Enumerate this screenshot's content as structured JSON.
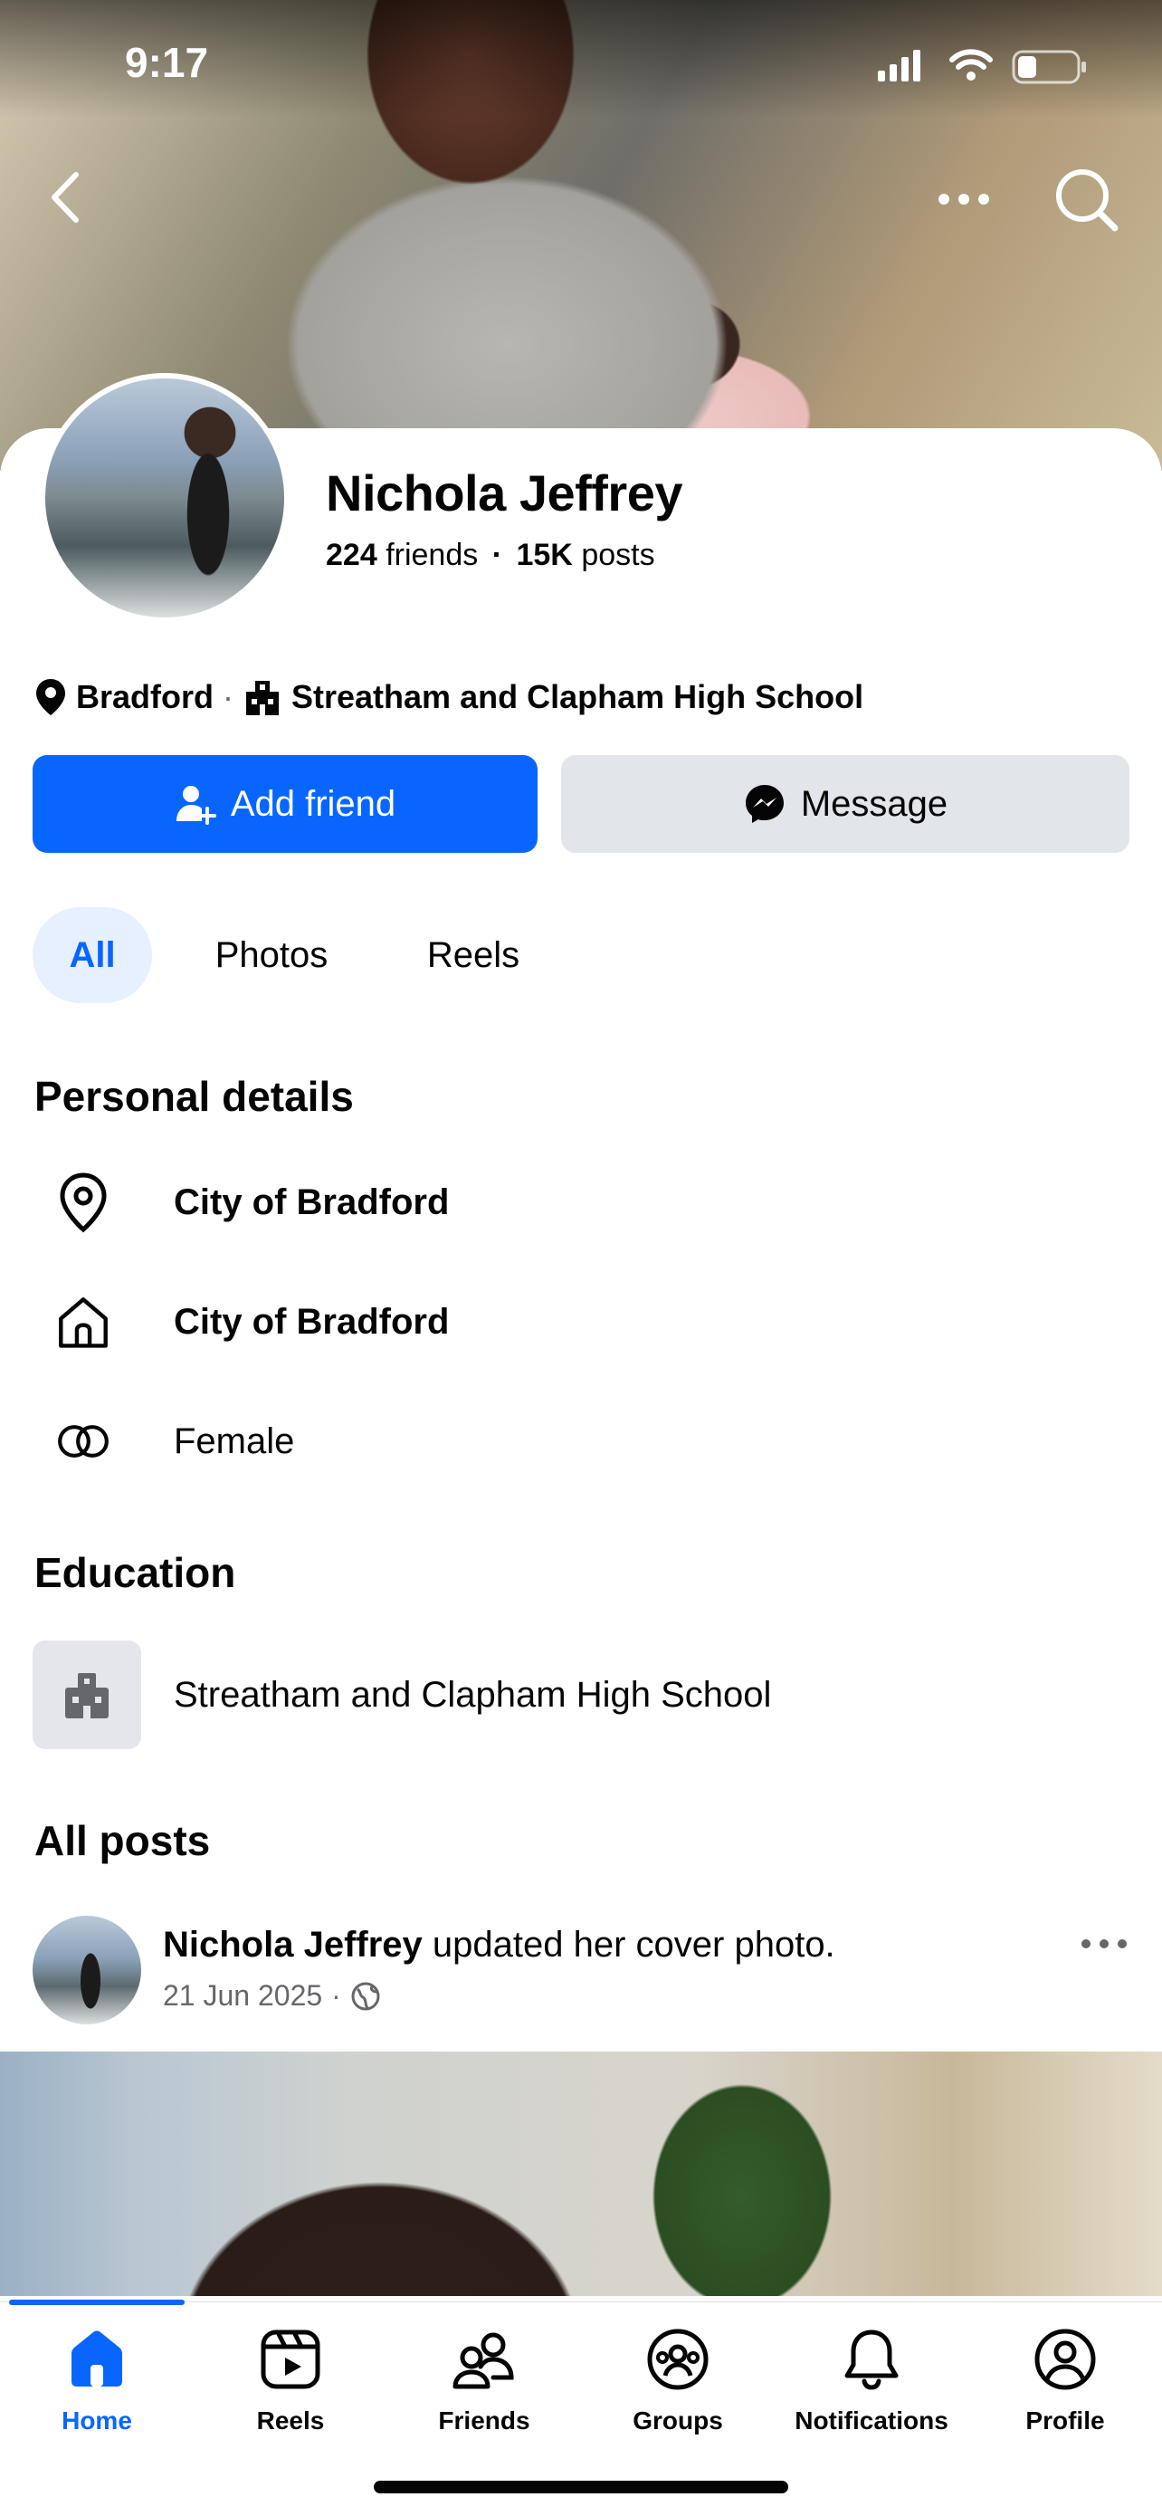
{
  "status_bar": {
    "time": "9:17"
  },
  "profile": {
    "name": "Nichola Jeffrey",
    "friends_count": "224",
    "friends_label": "friends",
    "separator": "·",
    "posts_count": "15K",
    "posts_label": "posts",
    "location": "Bradford",
    "school": "Streatham and Clapham High School"
  },
  "actions": {
    "add_friend": "Add friend",
    "message": "Message"
  },
  "tabs": [
    {
      "label": "All",
      "active": true
    },
    {
      "label": "Photos",
      "active": false
    },
    {
      "label": "Reels",
      "active": false
    }
  ],
  "personal_details": {
    "title": "Personal details",
    "items": [
      {
        "icon": "location-pin-icon",
        "text": "City of Bradford"
      },
      {
        "icon": "home-icon",
        "text": "City of Bradford"
      },
      {
        "icon": "gender-rings-icon",
        "text": "Female"
      }
    ]
  },
  "education": {
    "title": "Education",
    "school": "Streatham and Clapham High School"
  },
  "all_posts": {
    "title": "All posts",
    "post": {
      "author": "Nichola Jeffrey",
      "action": "updated her cover photo.",
      "date": "21 Jun 2025",
      "audience_icon": "globe-icon"
    }
  },
  "bottom_nav": [
    {
      "label": "Home",
      "icon": "home-icon",
      "active": true
    },
    {
      "label": "Reels",
      "icon": "reels-icon",
      "active": false
    },
    {
      "label": "Friends",
      "icon": "friends-icon",
      "active": false
    },
    {
      "label": "Groups",
      "icon": "groups-icon",
      "active": false
    },
    {
      "label": "Notifications",
      "icon": "bell-icon",
      "active": false
    },
    {
      "label": "Profile",
      "icon": "profile-icon",
      "active": false
    }
  ],
  "colors": {
    "accent": "#0866ff",
    "secondary_button": "#e2e5e9",
    "tab_active_bg": "#e6f0ff"
  }
}
